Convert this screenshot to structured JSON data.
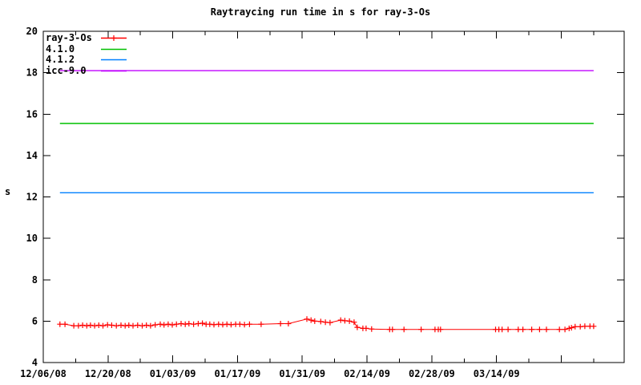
{
  "accent_colors": {
    "axis": "#000000",
    "background": "#ffffff"
  },
  "chart_data": {
    "type": "line",
    "title": "Raytraycing run time in s for ray-3-Os",
    "xlabel": "",
    "ylabel": "s",
    "grid": false,
    "legend_position": "top-left-inside",
    "ylim": [
      4,
      20
    ],
    "y_ticks": [
      4,
      6,
      8,
      10,
      12,
      14,
      16,
      18,
      20
    ],
    "x_days_origin_label": "12/06/08",
    "xlim_days": [
      0,
      125.6
    ],
    "x_major_ticks": [
      {
        "day": 0,
        "label": "12/06/08"
      },
      {
        "day": 14,
        "label": "12/20/08"
      },
      {
        "day": 28,
        "label": "01/03/09"
      },
      {
        "day": 42,
        "label": "01/17/09"
      },
      {
        "day": 56,
        "label": "01/31/09"
      },
      {
        "day": 70,
        "label": "02/14/09"
      },
      {
        "day": 84,
        "label": "02/28/09"
      },
      {
        "day": 98,
        "label": "03/14/09"
      },
      {
        "day": 112,
        "label": ""
      }
    ],
    "x_minor_tick_days": [
      7,
      21,
      35,
      49,
      63,
      77,
      91,
      105,
      119
    ],
    "series": [
      {
        "name": "ray-3-Os",
        "color": "#ff0000",
        "style": "linespoints",
        "marker": "plus",
        "points": [
          [
            3.6,
            5.85
          ],
          [
            4.7,
            5.85
          ],
          [
            6.6,
            5.78
          ],
          [
            7.6,
            5.78
          ],
          [
            8.5,
            5.8
          ],
          [
            9.4,
            5.78
          ],
          [
            10.2,
            5.8
          ],
          [
            11.1,
            5.78
          ],
          [
            12.0,
            5.8
          ],
          [
            12.9,
            5.78
          ],
          [
            13.9,
            5.82
          ],
          [
            14.8,
            5.8
          ],
          [
            15.8,
            5.78
          ],
          [
            16.8,
            5.8
          ],
          [
            17.7,
            5.78
          ],
          [
            18.5,
            5.8
          ],
          [
            19.4,
            5.78
          ],
          [
            20.4,
            5.8
          ],
          [
            21.4,
            5.78
          ],
          [
            22.3,
            5.8
          ],
          [
            23.2,
            5.78
          ],
          [
            24.2,
            5.82
          ],
          [
            25.3,
            5.85
          ],
          [
            26.1,
            5.82
          ],
          [
            27.0,
            5.85
          ],
          [
            27.9,
            5.82
          ],
          [
            28.8,
            5.85
          ],
          [
            29.8,
            5.88
          ],
          [
            30.7,
            5.85
          ],
          [
            31.5,
            5.88
          ],
          [
            32.5,
            5.85
          ],
          [
            33.5,
            5.88
          ],
          [
            34.4,
            5.9
          ],
          [
            35.2,
            5.85
          ],
          [
            36.0,
            5.85
          ],
          [
            36.9,
            5.83
          ],
          [
            37.9,
            5.85
          ],
          [
            38.8,
            5.83
          ],
          [
            39.7,
            5.85
          ],
          [
            40.6,
            5.83
          ],
          [
            41.6,
            5.85
          ],
          [
            42.5,
            5.85
          ],
          [
            43.5,
            5.83
          ],
          [
            44.6,
            5.85
          ],
          [
            47.1,
            5.85
          ],
          [
            51.3,
            5.88
          ],
          [
            53.0,
            5.88
          ],
          [
            57.0,
            6.1
          ],
          [
            57.9,
            6.05
          ],
          [
            58.7,
            6.0
          ],
          [
            60.0,
            5.98
          ],
          [
            61.0,
            5.95
          ],
          [
            62.0,
            5.93
          ],
          [
            64.3,
            6.05
          ],
          [
            65.2,
            6.02
          ],
          [
            66.2,
            6.0
          ],
          [
            67.2,
            5.95
          ],
          [
            67.9,
            5.7
          ],
          [
            69.1,
            5.65
          ],
          [
            69.8,
            5.65
          ],
          [
            71.0,
            5.62
          ],
          [
            74.9,
            5.6
          ],
          [
            75.5,
            5.6
          ],
          [
            78.0,
            5.6
          ],
          [
            81.7,
            5.6
          ],
          [
            84.7,
            5.6
          ],
          [
            85.4,
            5.6
          ],
          [
            85.9,
            5.6
          ],
          [
            97.8,
            5.6
          ],
          [
            98.5,
            5.6
          ],
          [
            99.2,
            5.6
          ],
          [
            100.5,
            5.6
          ],
          [
            102.7,
            5.6
          ],
          [
            103.7,
            5.6
          ],
          [
            105.6,
            5.6
          ],
          [
            107.3,
            5.6
          ],
          [
            108.8,
            5.6
          ],
          [
            111.6,
            5.6
          ],
          [
            112.8,
            5.6
          ],
          [
            113.7,
            5.65
          ],
          [
            114.2,
            5.68
          ],
          [
            115.0,
            5.73
          ],
          [
            116.1,
            5.73
          ],
          [
            117.1,
            5.75
          ],
          [
            118.2,
            5.75
          ],
          [
            119.0,
            5.75
          ]
        ]
      },
      {
        "name": "4.1.0",
        "color": "#00c000",
        "style": "line",
        "constant_value": 15.55,
        "span_days": [
          3.6,
          119
        ]
      },
      {
        "name": "4.1.2",
        "color": "#0080ff",
        "style": "line",
        "constant_value": 12.2,
        "span_days": [
          3.6,
          119
        ]
      },
      {
        "name": "icc-9.0",
        "color": "#c000ff",
        "style": "line",
        "constant_value": 18.1,
        "span_days": [
          3.6,
          119
        ]
      }
    ]
  }
}
